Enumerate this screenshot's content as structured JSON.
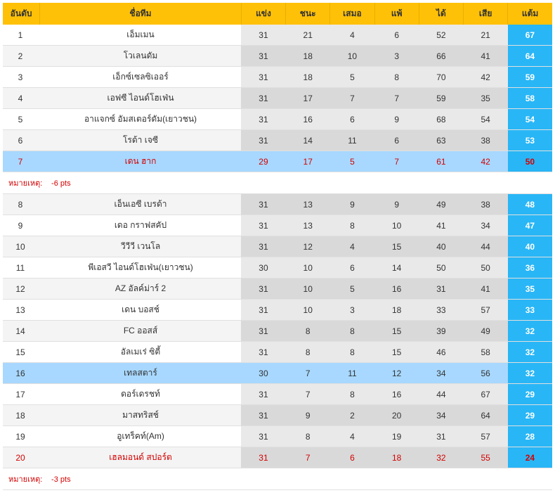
{
  "headers": {
    "rank": "อันดับ",
    "team": "ชื่อทีม",
    "played": "แข่ง",
    "win": "ชนะ",
    "draw": "เสมอ",
    "lose": "แพ้",
    "for": "ได้",
    "against": "เสีย",
    "points": "แต้ม"
  },
  "note_label": "หมายเหตุ:",
  "rows": [
    {
      "type": "data",
      "rank": "1",
      "team": "เอ็มเมน",
      "p": "31",
      "w": "21",
      "d": "4",
      "l": "6",
      "gf": "52",
      "ga": "21",
      "pts": "67",
      "red": false,
      "hl": false
    },
    {
      "type": "data",
      "rank": "2",
      "team": "โวเลนดัม",
      "p": "31",
      "w": "18",
      "d": "10",
      "l": "3",
      "gf": "66",
      "ga": "41",
      "pts": "64",
      "red": false,
      "hl": false
    },
    {
      "type": "data",
      "rank": "3",
      "team": "เอ็กซ์เซลซิเออร์",
      "p": "31",
      "w": "18",
      "d": "5",
      "l": "8",
      "gf": "70",
      "ga": "42",
      "pts": "59",
      "red": false,
      "hl": false
    },
    {
      "type": "data",
      "rank": "4",
      "team": "เอฟซี ไอนด์โฮเฟ่น",
      "p": "31",
      "w": "17",
      "d": "7",
      "l": "7",
      "gf": "59",
      "ga": "35",
      "pts": "58",
      "red": false,
      "hl": false
    },
    {
      "type": "data",
      "rank": "5",
      "team": "อาแจกซ์ อัมสเตอร์ดัม(เยาวชน)",
      "p": "31",
      "w": "16",
      "d": "6",
      "l": "9",
      "gf": "68",
      "ga": "54",
      "pts": "54",
      "red": false,
      "hl": false
    },
    {
      "type": "data",
      "rank": "6",
      "team": "โรด้า เจซี",
      "p": "31",
      "w": "14",
      "d": "11",
      "l": "6",
      "gf": "63",
      "ga": "38",
      "pts": "53",
      "red": false,
      "hl": false
    },
    {
      "type": "data",
      "rank": "7",
      "team": "เดน ฮาก",
      "p": "29",
      "w": "17",
      "d": "5",
      "l": "7",
      "gf": "61",
      "ga": "42",
      "pts": "50",
      "red": true,
      "hl": true
    },
    {
      "type": "note",
      "text": "-6 pts"
    },
    {
      "type": "data",
      "rank": "8",
      "team": "เอ็นเอซี เบรด้า",
      "p": "31",
      "w": "13",
      "d": "9",
      "l": "9",
      "gf": "49",
      "ga": "38",
      "pts": "48",
      "red": false,
      "hl": false
    },
    {
      "type": "data",
      "rank": "9",
      "team": "เดอ กราฟสคัป",
      "p": "31",
      "w": "13",
      "d": "8",
      "l": "10",
      "gf": "41",
      "ga": "34",
      "pts": "47",
      "red": false,
      "hl": false
    },
    {
      "type": "data",
      "rank": "10",
      "team": "วีวีวี เวนโล",
      "p": "31",
      "w": "12",
      "d": "4",
      "l": "15",
      "gf": "40",
      "ga": "44",
      "pts": "40",
      "red": false,
      "hl": false
    },
    {
      "type": "data",
      "rank": "11",
      "team": "พีเอสวี ไอนด์โฮเฟ่น(เยาวชน)",
      "p": "30",
      "w": "10",
      "d": "6",
      "l": "14",
      "gf": "50",
      "ga": "50",
      "pts": "36",
      "red": false,
      "hl": false
    },
    {
      "type": "data",
      "rank": "12",
      "team": "AZ อัลค์ม่าร์ 2",
      "p": "31",
      "w": "10",
      "d": "5",
      "l": "16",
      "gf": "31",
      "ga": "41",
      "pts": "35",
      "red": false,
      "hl": false
    },
    {
      "type": "data",
      "rank": "13",
      "team": "เดน บอสช์",
      "p": "31",
      "w": "10",
      "d": "3",
      "l": "18",
      "gf": "33",
      "ga": "57",
      "pts": "33",
      "red": false,
      "hl": false
    },
    {
      "type": "data",
      "rank": "14",
      "team": "FC ออสส์",
      "p": "31",
      "w": "8",
      "d": "8",
      "l": "15",
      "gf": "39",
      "ga": "49",
      "pts": "32",
      "red": false,
      "hl": false
    },
    {
      "type": "data",
      "rank": "15",
      "team": "อัลเมเร่ ซิตี้",
      "p": "31",
      "w": "8",
      "d": "8",
      "l": "15",
      "gf": "46",
      "ga": "58",
      "pts": "32",
      "red": false,
      "hl": false
    },
    {
      "type": "data",
      "rank": "16",
      "team": "เทลสตาร์",
      "p": "30",
      "w": "7",
      "d": "11",
      "l": "12",
      "gf": "34",
      "ga": "56",
      "pts": "32",
      "red": false,
      "hl": true
    },
    {
      "type": "data",
      "rank": "17",
      "team": "ดอร์เดรชท์",
      "p": "31",
      "w": "7",
      "d": "8",
      "l": "16",
      "gf": "44",
      "ga": "67",
      "pts": "29",
      "red": false,
      "hl": false
    },
    {
      "type": "data",
      "rank": "18",
      "team": "มาสทริสช์",
      "p": "31",
      "w": "9",
      "d": "2",
      "l": "20",
      "gf": "34",
      "ga": "64",
      "pts": "29",
      "red": false,
      "hl": false
    },
    {
      "type": "data",
      "rank": "19",
      "team": "อูเทร็คท์(Am)",
      "p": "31",
      "w": "8",
      "d": "4",
      "l": "19",
      "gf": "31",
      "ga": "57",
      "pts": "28",
      "red": false,
      "hl": false
    },
    {
      "type": "data",
      "rank": "20",
      "team": "เฮลมอนด์ สปอร์ต",
      "p": "31",
      "w": "7",
      "d": "6",
      "l": "18",
      "gf": "32",
      "ga": "55",
      "pts": "24",
      "red": true,
      "hl": false
    },
    {
      "type": "note",
      "text": "-3 pts"
    }
  ]
}
